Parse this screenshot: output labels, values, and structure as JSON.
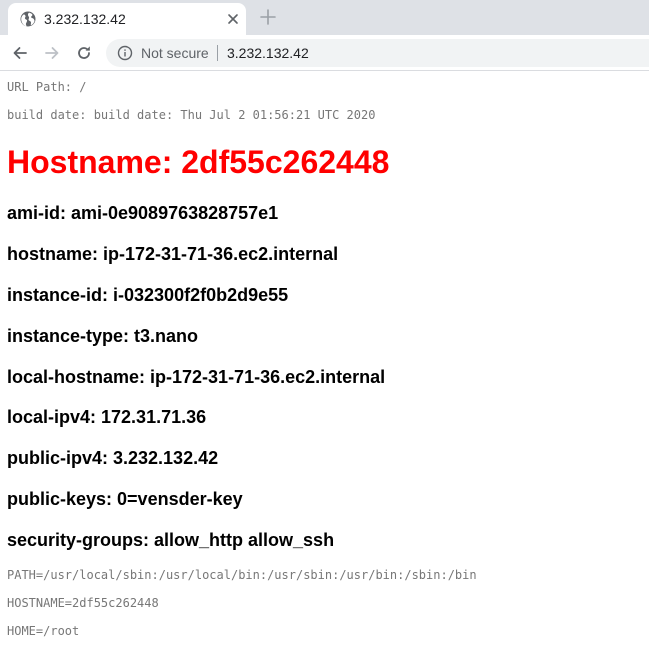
{
  "browser": {
    "tab": {
      "title": "3.232.132.42",
      "favicon": "globe-icon",
      "close": "close-icon"
    },
    "new_tab": "plus-icon",
    "toolbar": {
      "back": "arrow-left-icon",
      "forward": "arrow-right-icon",
      "reload": "reload-icon",
      "security_icon": "info-icon",
      "security_label": "Not secure",
      "url": "3.232.132.42"
    }
  },
  "page": {
    "url_path": "URL Path: /",
    "build_date": "build date: build date: Thu Jul 2 01:56:21 UTC 2020",
    "hostname_heading": "Hostname: 2df55c262448",
    "heading_color": "#ff0000",
    "metadata": [
      {
        "label": "ami-id: ami-0e9089763828757e1"
      },
      {
        "label": "hostname: ip-172-31-71-36.ec2.internal"
      },
      {
        "label": "instance-id: i-032300f2f0b2d9e55"
      },
      {
        "label": "instance-type: t3.nano"
      },
      {
        "label": "local-hostname: ip-172-31-71-36.ec2.internal"
      },
      {
        "label": "local-ipv4: 172.31.71.36"
      },
      {
        "label": "public-ipv4: 3.232.132.42"
      },
      {
        "label": "public-keys: 0=vensder-key"
      },
      {
        "label": "security-groups: allow_http allow_ssh"
      }
    ],
    "env": [
      {
        "line": "PATH=/usr/local/sbin:/usr/local/bin:/usr/sbin:/usr/bin:/sbin:/bin"
      },
      {
        "line": "HOSTNAME=2df55c262448"
      },
      {
        "line": "HOME=/root"
      }
    ]
  }
}
